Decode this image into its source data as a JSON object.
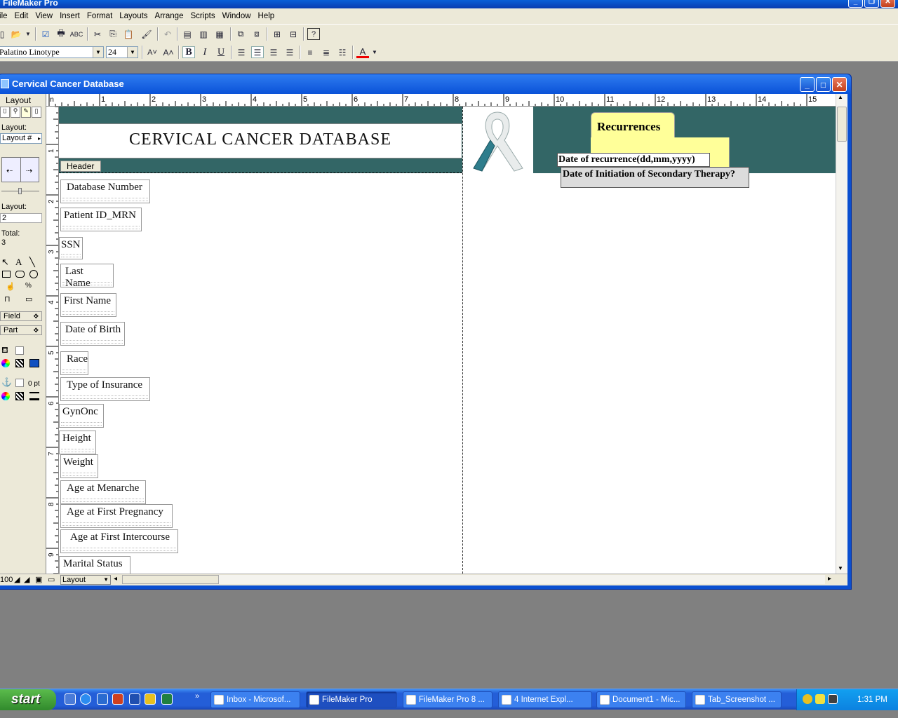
{
  "app": {
    "title": "FileMaker Pro",
    "menu": [
      "File",
      "Edit",
      "View",
      "Insert",
      "Format",
      "Layouts",
      "Arrange",
      "Scripts",
      "Window",
      "Help"
    ]
  },
  "format_bar": {
    "font_name": "Palatino Linotype",
    "font_size": "24",
    "bold_label": "B",
    "italic_label": "I",
    "underline_label": "U",
    "text_color_label": "A"
  },
  "document": {
    "title": "Cervical Cancer Database",
    "ruler_unit": "in",
    "h_ruler_ticks": [
      "1",
      "2",
      "3",
      "4",
      "5",
      "6",
      "7",
      "8",
      "9",
      "10",
      "11",
      "12",
      "13",
      "14",
      "15"
    ],
    "v_ruler_ticks": [
      "1",
      "2",
      "3",
      "4",
      "5",
      "6",
      "7",
      "8",
      "9"
    ]
  },
  "status_area": {
    "mode_label": "Layout",
    "layout_label": "Layout:",
    "layout_select": "Layout #",
    "layout_number_label": "Layout:",
    "layout_number": "2",
    "total_label": "Total:",
    "total_value": "3",
    "field_tool": "Field",
    "part_tool": "Part",
    "line_width": "0 pt",
    "zoom": "100",
    "mode_select": "Layout"
  },
  "layout": {
    "header_title": "CERVICAL CANCER DATABASE",
    "header_part_label": "Header",
    "fields": [
      "Database Number",
      "Patient ID_MRN",
      "SSN",
      "Last Name",
      "First Name",
      "Date of Birth",
      "Race",
      "Type of Insurance",
      "GynOnc",
      "Height",
      "Weight",
      "Age at Menarche",
      "Age at First Pregnancy",
      "Age at First Intercourse",
      "Marital Status"
    ],
    "tab_label": "Recurrences",
    "tab_fields": [
      "Date of recurrence(dd,mm,yyyy)",
      "Date of Initiation of Secondary Therapy?"
    ]
  },
  "taskbar": {
    "start_label": "start",
    "tasks": [
      "Inbox - Microsof...",
      "FileMaker Pro",
      "FileMaker Pro 8 ...",
      "4 Internet Expl...",
      "Document1 - Mic...",
      "Tab_Screenshot ..."
    ],
    "clock": "1:31 PM"
  },
  "colors": {
    "header_teal": "#336666",
    "tab_yellow": "#ffff99",
    "xp_blue": "#0a52d8"
  }
}
